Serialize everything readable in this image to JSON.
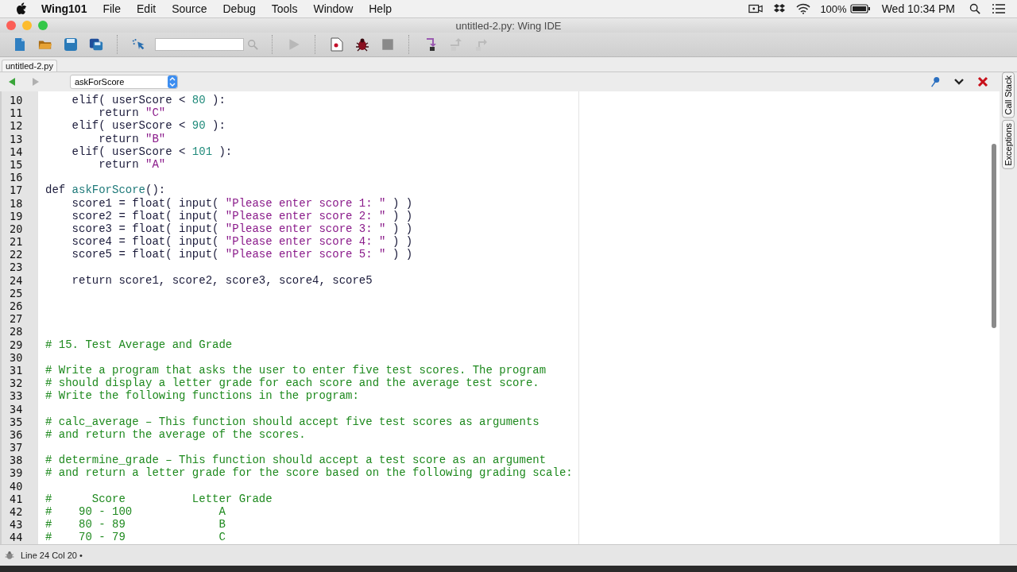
{
  "menu_bar": {
    "app": "Wing101",
    "items": [
      "File",
      "Edit",
      "Source",
      "Debug",
      "Tools",
      "Window",
      "Help"
    ],
    "battery": "100%",
    "clock": "Wed 10:34 PM"
  },
  "window": {
    "title": "untitled-2.py: Wing IDE"
  },
  "tabs": [
    {
      "label": "untitled-2.py",
      "selected": true
    }
  ],
  "scope": {
    "value": "askForScore"
  },
  "side_tabs": [
    "Call Stack",
    "Exceptions"
  ],
  "code": [
    {
      "n": "10",
      "t": [
        {
          "kind": "txt",
          "text": "    elif( userScore < "
        },
        {
          "kind": "num",
          "text": "80"
        },
        {
          "kind": "txt",
          "text": " ):"
        }
      ]
    },
    {
      "n": "11",
      "t": [
        {
          "kind": "txt",
          "text": "        return "
        },
        {
          "kind": "str",
          "text": "\"C\""
        }
      ]
    },
    {
      "n": "12",
      "t": [
        {
          "kind": "txt",
          "text": "    elif( userScore < "
        },
        {
          "kind": "num",
          "text": "90"
        },
        {
          "kind": "txt",
          "text": " ):"
        }
      ]
    },
    {
      "n": "13",
      "t": [
        {
          "kind": "txt",
          "text": "        return "
        },
        {
          "kind": "str",
          "text": "\"B\""
        }
      ]
    },
    {
      "n": "14",
      "t": [
        {
          "kind": "txt",
          "text": "    elif( userScore < "
        },
        {
          "kind": "num",
          "text": "101"
        },
        {
          "kind": "txt",
          "text": " ):"
        }
      ]
    },
    {
      "n": "15",
      "t": [
        {
          "kind": "txt",
          "text": "        return "
        },
        {
          "kind": "str",
          "text": "\"A\""
        }
      ]
    },
    {
      "n": "16"
    },
    {
      "n": "17",
      "t": [
        {
          "kind": "txt",
          "text": "def "
        },
        {
          "kind": "fn",
          "text": "askForScore"
        },
        {
          "kind": "txt",
          "text": "():"
        }
      ]
    },
    {
      "n": "18",
      "t": [
        {
          "kind": "txt",
          "text": "    score1 = float( input( "
        },
        {
          "kind": "str",
          "text": "\"Please enter score 1: \""
        },
        {
          "kind": "txt",
          "text": " ) )"
        }
      ]
    },
    {
      "n": "19",
      "t": [
        {
          "kind": "txt",
          "text": "    score2 = float( input( "
        },
        {
          "kind": "str",
          "text": "\"Please enter score 2: \""
        },
        {
          "kind": "txt",
          "text": " ) )"
        }
      ]
    },
    {
      "n": "20",
      "t": [
        {
          "kind": "txt",
          "text": "    score3 = float( input( "
        },
        {
          "kind": "str",
          "text": "\"Please enter score 3: \""
        },
        {
          "kind": "txt",
          "text": " ) )"
        }
      ]
    },
    {
      "n": "21",
      "t": [
        {
          "kind": "txt",
          "text": "    score4 = float( input( "
        },
        {
          "kind": "str",
          "text": "\"Please enter score 4: \""
        },
        {
          "kind": "txt",
          "text": " ) )"
        }
      ]
    },
    {
      "n": "22",
      "t": [
        {
          "kind": "txt",
          "text": "    score5 = float( input( "
        },
        {
          "kind": "str",
          "text": "\"Please enter score 5: \""
        },
        {
          "kind": "txt",
          "text": " ) )"
        }
      ]
    },
    {
      "n": "23"
    },
    {
      "n": "24",
      "t": [
        {
          "kind": "txt",
          "text": "    return score1, score2, score3, score4, score5"
        }
      ]
    },
    {
      "n": "25"
    },
    {
      "n": "26"
    },
    {
      "n": "27"
    },
    {
      "n": "28"
    },
    {
      "n": "29",
      "t": [
        {
          "kind": "com",
          "text": "# 15. Test Average and Grade"
        }
      ]
    },
    {
      "n": "30"
    },
    {
      "n": "31",
      "t": [
        {
          "kind": "com",
          "text": "# Write a program that asks the user to enter five test scores. The program"
        }
      ]
    },
    {
      "n": "32",
      "t": [
        {
          "kind": "com",
          "text": "# should display a letter grade for each score and the average test score."
        }
      ]
    },
    {
      "n": "33",
      "t": [
        {
          "kind": "com",
          "text": "# Write the following functions in the program:"
        }
      ]
    },
    {
      "n": "34"
    },
    {
      "n": "35",
      "t": [
        {
          "kind": "com",
          "text": "# calc_average – This function should accept five test scores as arguments"
        }
      ]
    },
    {
      "n": "36",
      "t": [
        {
          "kind": "com",
          "text": "# and return the average of the scores."
        }
      ]
    },
    {
      "n": "37"
    },
    {
      "n": "38",
      "t": [
        {
          "kind": "com",
          "text": "# determine_grade – This function should accept a test score as an argument"
        }
      ]
    },
    {
      "n": "39",
      "t": [
        {
          "kind": "com",
          "text": "# and return a letter grade for the score based on the following grading scale:"
        }
      ]
    },
    {
      "n": "40"
    },
    {
      "n": "41",
      "t": [
        {
          "kind": "com",
          "text": "#      Score          Letter Grade"
        }
      ]
    },
    {
      "n": "42",
      "t": [
        {
          "kind": "com",
          "text": "#    90 - 100             A"
        }
      ]
    },
    {
      "n": "43",
      "t": [
        {
          "kind": "com",
          "text": "#    80 - 89              B"
        }
      ]
    },
    {
      "n": "44",
      "t": [
        {
          "kind": "com",
          "text": "#    70 - 79              C"
        }
      ]
    }
  ],
  "status_bar": {
    "text": "Line 24 Col 20 •"
  }
}
